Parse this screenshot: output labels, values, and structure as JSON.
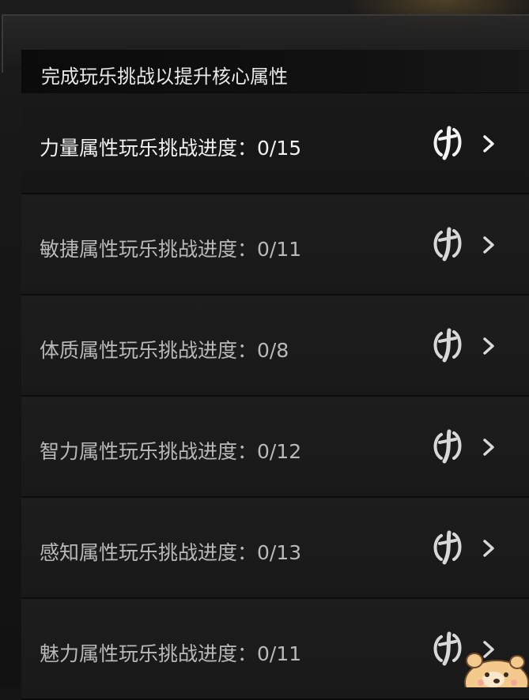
{
  "header": {
    "title": "完成玩乐挑战以提升核心属性"
  },
  "rows": [
    {
      "label": "力量属性玩乐挑战进度：0/15",
      "icon": "brush-glyph-icon",
      "active": true
    },
    {
      "label": "敏捷属性玩乐挑战进度：0/11",
      "icon": "brush-glyph-icon",
      "active": false
    },
    {
      "label": "体质属性玩乐挑战进度：0/8",
      "icon": "brush-glyph-icon",
      "active": false
    },
    {
      "label": "智力属性玩乐挑战进度：0/12",
      "icon": "brush-glyph-icon",
      "active": false
    },
    {
      "label": "感知属性玩乐挑战进度：0/13",
      "icon": "brush-glyph-icon",
      "active": false
    },
    {
      "label": "魅力属性玩乐挑战进度：0/11",
      "icon": "brush-glyph-icon",
      "active": false
    }
  ],
  "colors": {
    "text_active": "#f2f2f2",
    "text_normal": "#b9b9b9",
    "panel": "#1b1b1b",
    "accent_mascot": "#f4c98c"
  }
}
